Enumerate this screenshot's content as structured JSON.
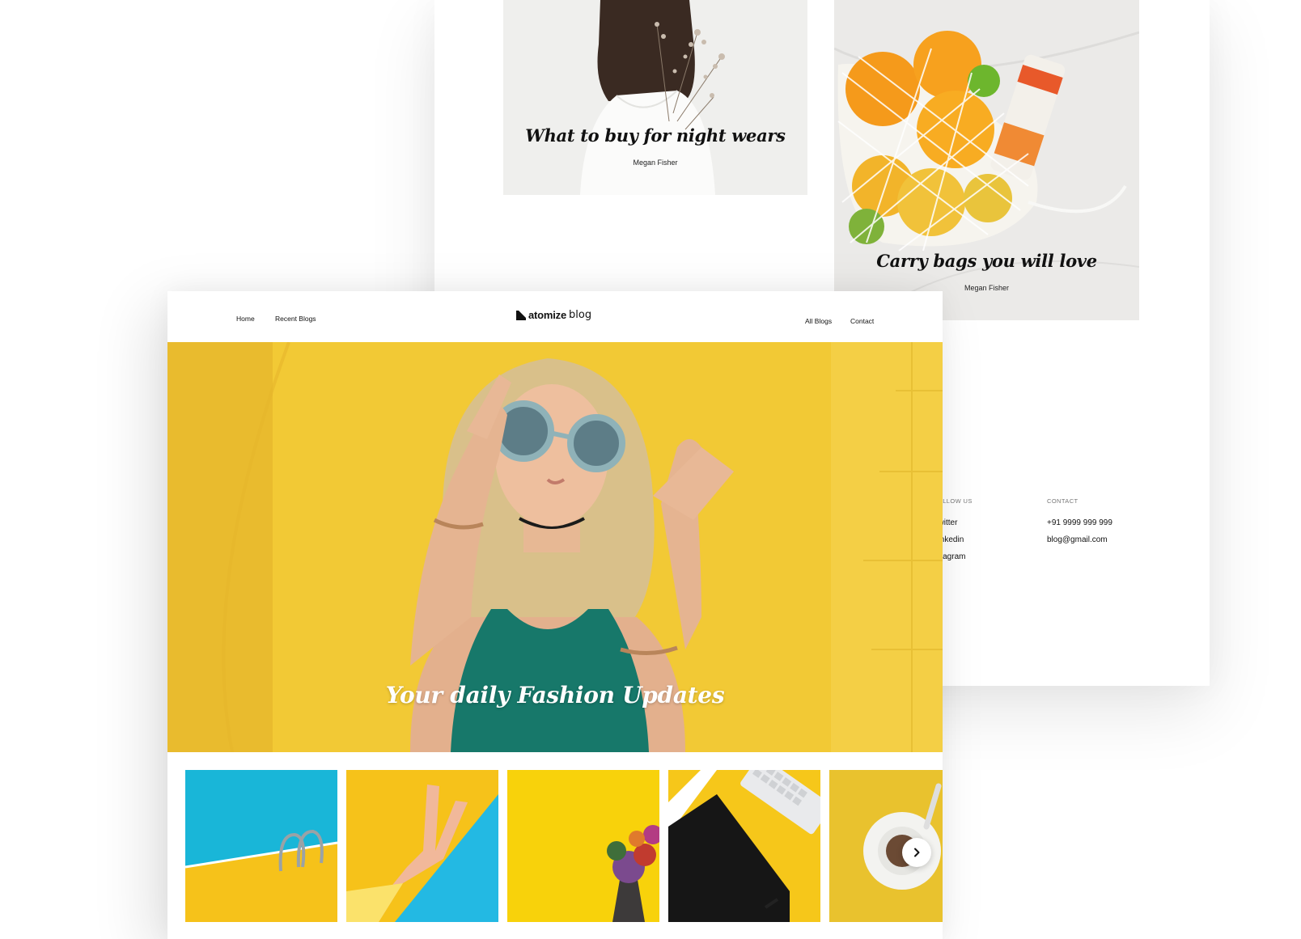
{
  "back_page": {
    "cards": [
      {
        "title": "What to buy for night wears",
        "author": "Megan Fisher"
      },
      {
        "title": "Carry bags you will love",
        "author": "Megan Fisher"
      }
    ],
    "footer": {
      "follow_heading": "FOLLOW US",
      "follow_links": [
        "Twitter",
        "Linkedin",
        "Intagram"
      ],
      "contact_heading": "CONTACT",
      "phone": "+91 9999 999 999",
      "email": "blog@gmail.com"
    }
  },
  "front_page": {
    "nav": {
      "home": "Home",
      "recent": "Recent Blogs",
      "all": "All Blogs",
      "contact": "Contact"
    },
    "logo": {
      "brand": "atomize",
      "suffix": "blog"
    },
    "hero": {
      "title": "Your daily Fashion Updates"
    },
    "thumbnails": [
      {
        "name": "pool-ladder"
      },
      {
        "name": "peace-hand"
      },
      {
        "name": "flower-bouquet"
      },
      {
        "name": "keyboard-tablet"
      },
      {
        "name": "coffee-cup"
      }
    ],
    "carousel_next_icon": "chevron-right-icon"
  },
  "colors": {
    "accent_yellow": "#f2c935",
    "pool_blue": "#19b6d8",
    "text": "#111111"
  }
}
